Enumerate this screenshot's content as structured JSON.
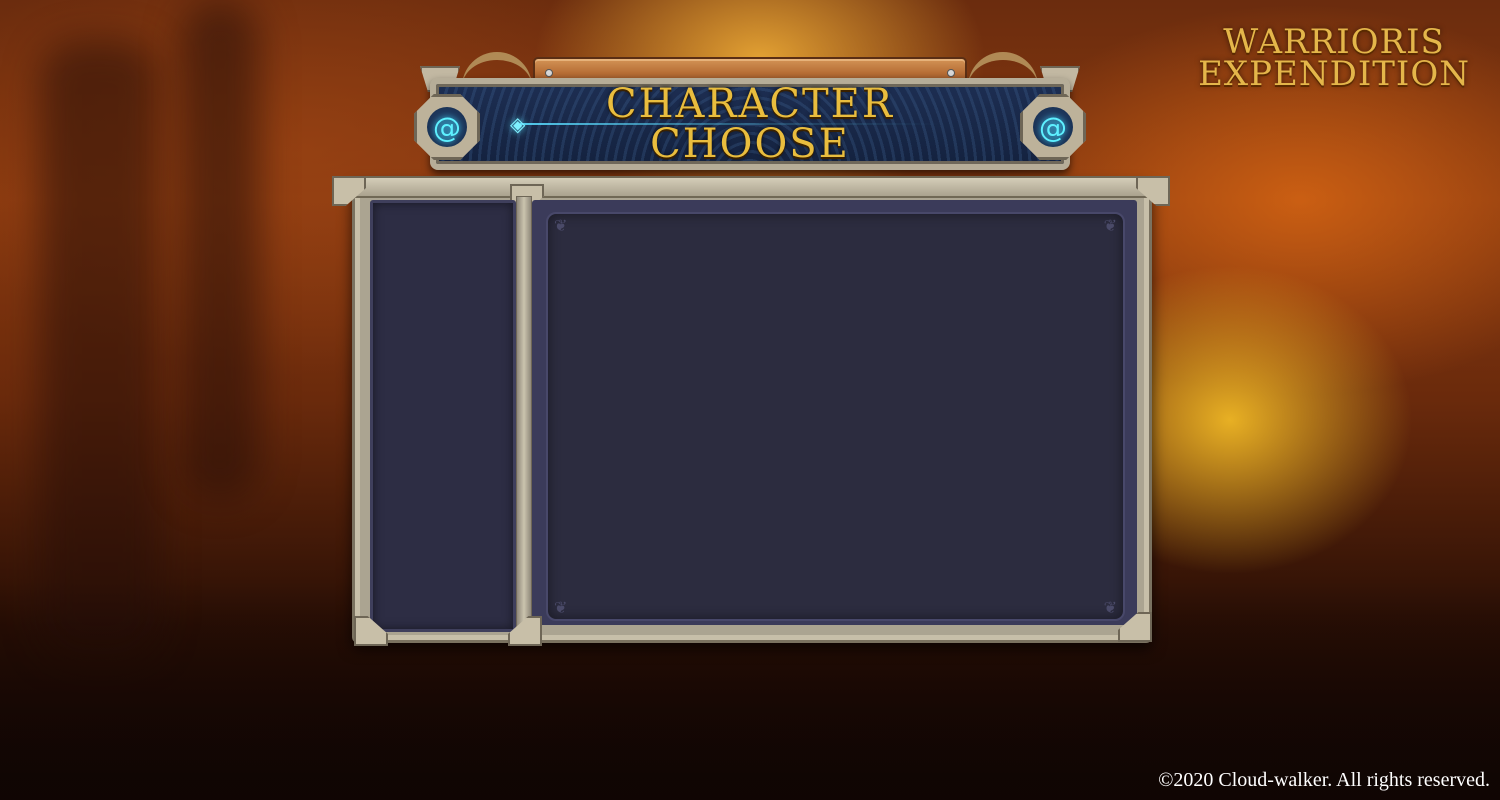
{
  "game": {
    "logo_line1": "WARRIORIS",
    "logo_line2": "EXPENDITION"
  },
  "screen": {
    "title_line1": "CHARACTER",
    "title_line2": "CHOOSE"
  },
  "icons": {
    "emblem_left": "spiral-icon",
    "emblem_right": "spiral-icon",
    "spark": "rune-spark-icon"
  },
  "panels": {
    "character_list": "",
    "character_detail": ""
  },
  "footer": {
    "copyright": "©2020 Cloud-walker. All rights reserved."
  },
  "colors": {
    "title_gold": "#e9bd3e",
    "panel_dark": "#2c2c3f",
    "stone_frame": "#aba491",
    "emblem_glow": "#5ef0ff"
  }
}
